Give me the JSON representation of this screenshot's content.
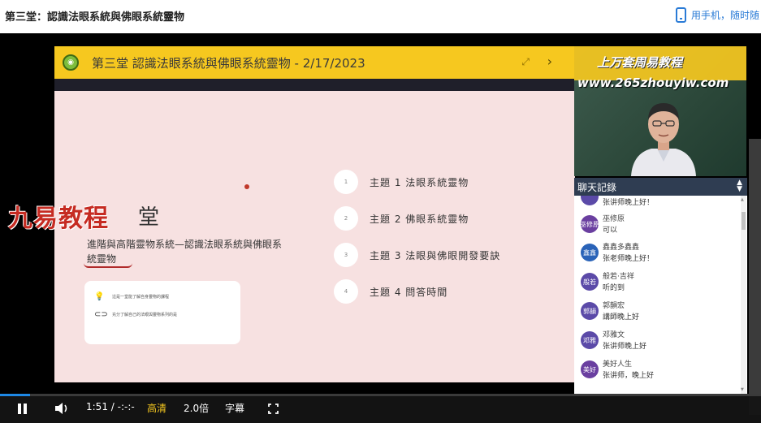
{
  "page": {
    "title": "第三堂：認識法眼系統與佛眼系統靈物",
    "phone_link": "用手机，随时随"
  },
  "slide": {
    "header_title": "第三堂 認識法眼系統與佛眼系統靈物 - 2/17/2023",
    "ctrl_a": "⤢",
    "ctrl_b": "›",
    "watermark": "九易教程",
    "watermark_tail": "堂",
    "subtitle": "進階與高階靈物系統—認識法眼系統與佛眼系統靈物",
    "notes": [
      {
        "icon": "lightbulb-icon",
        "glyph": "💡",
        "text": "這是一堂能了解自身靈物的課程"
      },
      {
        "icon": "link-icon",
        "glyph": "⊂⊃",
        "text": "充分了解自己的法眼與靈物系列的是"
      }
    ],
    "topics": [
      {
        "num": "1",
        "label": "主題 1  法眼系統靈物"
      },
      {
        "num": "2",
        "label": "主題 2  佛眼系統靈物"
      },
      {
        "num": "3",
        "label": "主題 3  法眼與佛眼開發要訣"
      },
      {
        "num": "4",
        "label": "主題 4  問答時間"
      }
    ]
  },
  "camera": {
    "line1": "上万套周易教程",
    "line2": "www.265zhouyiw.com"
  },
  "chat": {
    "header": "聊天記錄",
    "messages": [
      {
        "avatar": "",
        "name": "",
        "msg": "张讲师晚上好！",
        "color": "#5b4aa8"
      },
      {
        "avatar": "巫修原",
        "name": "巫修原",
        "msg": "可以",
        "color": "#6a3fa0"
      },
      {
        "avatar": "鑫鑫",
        "name": "鑫鑫多鑫鑫",
        "msg": "张老师晚上好！",
        "color": "#2a63b8"
      },
      {
        "avatar": "般若",
        "name": "般若·吉祥",
        "msg": "听的到",
        "color": "#5b4aa8"
      },
      {
        "avatar": "郭韻",
        "name": "郭韻宏",
        "msg": "講師晚上好",
        "color": "#5b4aa8"
      },
      {
        "avatar": "邓雅",
        "name": "邓雅文",
        "msg": "张讲师晚上好",
        "color": "#5b4aa8"
      },
      {
        "avatar": "美好",
        "name": "美好人生",
        "msg": "张讲师，晚上好",
        "color": "#6a3fa0"
      }
    ]
  },
  "controls": {
    "time": "1:51 / -:-:-",
    "quality": "高清",
    "speed": "2.0倍",
    "subtitles": "字幕",
    "progress": 0.04
  },
  "colors": {
    "accent": "#f6c81f",
    "slide_bg": "#f7e1e1",
    "chat_header": "#2f3d52",
    "link": "#2a7bd6"
  }
}
